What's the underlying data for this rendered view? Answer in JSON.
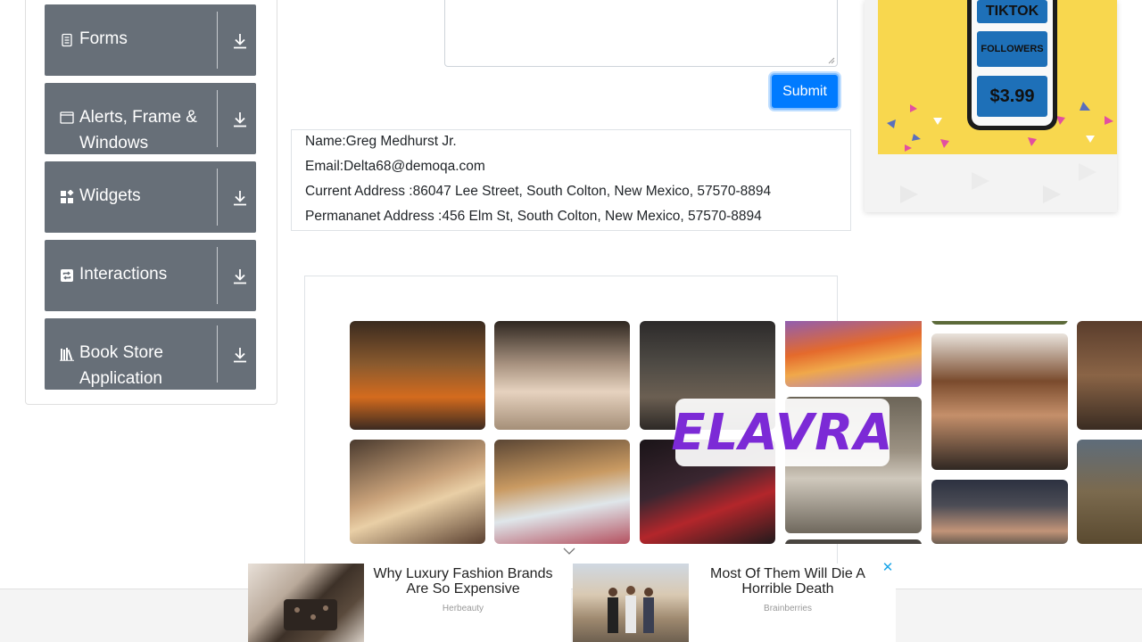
{
  "sidebar": {
    "items": [
      {
        "label": "Forms",
        "icon": "form-icon"
      },
      {
        "label": "Alerts, Frame & Windows",
        "icon": "window-icon"
      },
      {
        "label": "Widgets",
        "icon": "widgets-icon"
      },
      {
        "label": "Interactions",
        "icon": "interactions-icon"
      },
      {
        "label": "Book Store Application",
        "icon": "book-icon"
      }
    ],
    "download_icon": "download-icon"
  },
  "form": {
    "submit_label": "Submit"
  },
  "output": {
    "name": "Name:Greg Medhurst Jr.",
    "email": "Email:Delta68@demoqa.com",
    "current_address": "Current Address :86047 Lee Street, South Colton, New Mexico, 57570-8894",
    "permanent_address": "Permananet Address :456 Elm St, South Colton, New Mexico, 57570-8894"
  },
  "right_ad": {
    "line1": "TIKTOK",
    "line2": "FOLLOWERS",
    "price": "$3.99"
  },
  "mosaic": {
    "logo_text": "ELAVRA"
  },
  "bottom_ads": [
    {
      "title": "Why Luxury Fashion Brands Are So Expensive",
      "source": "Herbeauty"
    },
    {
      "title": "Most Of Them Will Die A Horrible Death",
      "source": "Brainberries"
    }
  ],
  "colors": {
    "sidebar_item": "#676f78",
    "submit": "#007bff",
    "ad_yellow": "#f8d74e",
    "logo": "#7c2ad6",
    "close": "#1aa5e8"
  }
}
